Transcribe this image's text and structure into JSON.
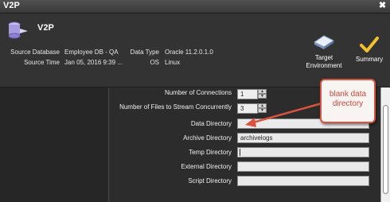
{
  "window": {
    "title": "V2P",
    "close_glyph": "✖"
  },
  "header": {
    "app_name": "V2P",
    "app_icon": "v2p-database-icon",
    "source_database_label": "Source Database",
    "source_database_value": "Employee DB - QA",
    "source_time_label": "Source Time",
    "source_time_value": "Jan 05, 2016 9:39 ...",
    "data_type_label": "Data Type",
    "data_type_value": "Oracle 11.2.0.1.0",
    "os_label": "OS",
    "os_value": "Linux",
    "target_env_label_1": "Target",
    "target_env_label_2": "Environment",
    "summary_label": "Summary"
  },
  "form": {
    "connections_label": "Number of Connections",
    "connections_value": "1",
    "files_stream_label": "Number of Files to Stream Concurrently",
    "files_stream_value": "3",
    "data_dir_label": "Data Directory",
    "data_dir_value": "",
    "archive_dir_label": "Archive Directory",
    "archive_dir_value": "archivelogs",
    "temp_dir_label": "Temp Directory",
    "temp_dir_value": "",
    "external_dir_label": "External Directory",
    "external_dir_value": "",
    "script_dir_label": "Script Directory",
    "script_dir_value": ""
  },
  "annotation": {
    "line1": "blank data",
    "line2": "directory"
  },
  "colors": {
    "callout_border": "#d9533f",
    "summary_check": "#f2c12e"
  }
}
